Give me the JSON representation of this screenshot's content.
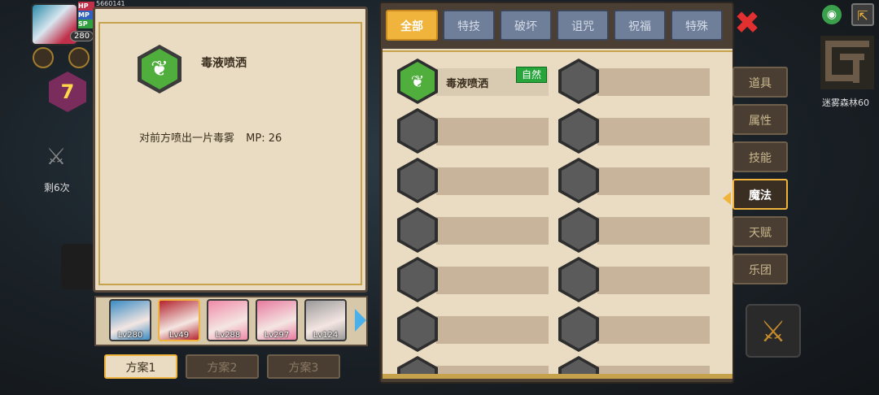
{
  "hud": {
    "level": "280",
    "hp_label": "HP",
    "mp_label": "MP",
    "sp_label": "SP",
    "gold": "5660141",
    "floor": "7",
    "remaining": "剩6次"
  },
  "detail": {
    "skill_name": "毒液喷洒",
    "description": "对前方喷出一片毒雾",
    "mp_cost": "MP: 26",
    "icon": "poison-leaf-icon"
  },
  "characters": [
    {
      "level": "Lv280",
      "color": "#3a8cc4"
    },
    {
      "level": "Lv49",
      "color": "#b3242e",
      "selected": true
    },
    {
      "level": "Lv288",
      "color": "#f08aa8"
    },
    {
      "level": "Lv297",
      "color": "#e87aa0"
    },
    {
      "level": "Lv124",
      "color": "#9a9a9a"
    }
  ],
  "plans": [
    {
      "label": "方案1",
      "active": true
    },
    {
      "label": "方案2",
      "active": false
    },
    {
      "label": "方案3",
      "active": false
    }
  ],
  "tabs": [
    {
      "label": "全部",
      "active": true
    },
    {
      "label": "特技",
      "active": false
    },
    {
      "label": "破坏",
      "active": false
    },
    {
      "label": "诅咒",
      "active": false
    },
    {
      "label": "祝福",
      "active": false
    },
    {
      "label": "特殊",
      "active": false
    }
  ],
  "skills": [
    {
      "name": "毒液喷洒",
      "tag": "自然",
      "filled": true
    },
    {
      "name": "",
      "tag": "",
      "filled": false
    }
  ],
  "side_menu": [
    {
      "label": "道具",
      "active": false
    },
    {
      "label": "属性",
      "active": false
    },
    {
      "label": "技能",
      "active": false
    },
    {
      "label": "魔法",
      "active": true
    },
    {
      "label": "天赋",
      "active": false
    },
    {
      "label": "乐团",
      "active": false
    }
  ],
  "map": {
    "label": "迷雾森林60"
  },
  "colors": {
    "accent": "#f0b43c",
    "panel": "#e9dcc3",
    "nature_tag": "#25a53a",
    "skill_green": "#4fae3c"
  }
}
